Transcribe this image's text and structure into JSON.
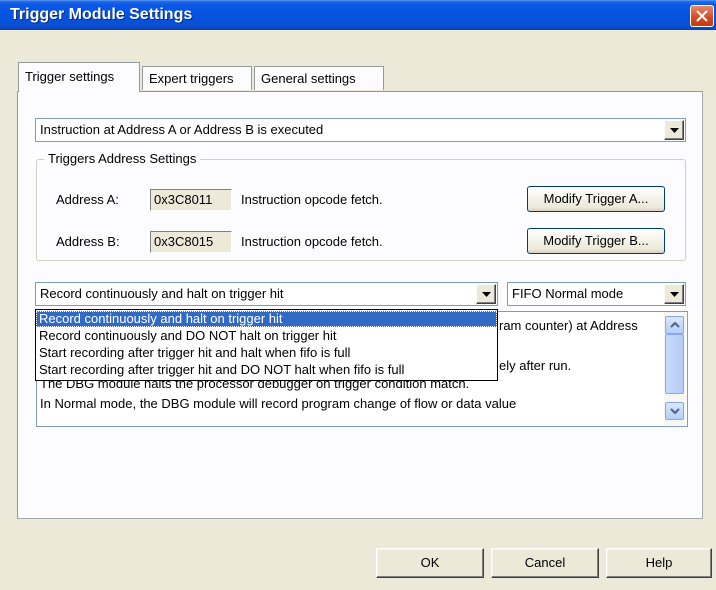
{
  "window": {
    "title": "Trigger Module Settings"
  },
  "tabs": [
    {
      "label": "Trigger settings",
      "active": true
    },
    {
      "label": "Expert triggers",
      "active": false
    },
    {
      "label": "General settings",
      "active": false
    }
  ],
  "trigger_mode": {
    "value": "Instruction at Address A or Address B is executed"
  },
  "address_group": {
    "title": "Triggers Address Settings",
    "address_a": {
      "label": "Address A:",
      "value": "0x3C8011",
      "description": "Instruction opcode fetch.",
      "button": "Modify Trigger A..."
    },
    "address_b": {
      "label": "Address B:",
      "value": "0x3C8015",
      "description": "Instruction opcode fetch.",
      "button": "Modify Trigger B..."
    }
  },
  "record_mode": {
    "value": "Record continuously and halt on trigger hit",
    "options": [
      "Record continuously and halt on trigger hit",
      "Record continuously and DO NOT halt on trigger hit",
      "Start recording after trigger hit and halt when fifo is full",
      "Start recording after trigger hit and DO NOT halt when fifo is full"
    ],
    "selected_index": 0
  },
  "fifo_mode": {
    "value": "FIFO Normal mode"
  },
  "description_text": {
    "line1_tail": "ram counter) at Address",
    "line2_tail": "ely after run.",
    "line3_partial": "The DBG module halts the processor debugger on trigger condition match.",
    "line4": "In Normal mode, the DBG module will record program change of flow or data value"
  },
  "buttons": {
    "ok": "OK",
    "cancel": "Cancel",
    "help": "Help"
  },
  "icons": {
    "close": "close-icon",
    "dropdown": "chevron-down-icon",
    "scroll_up": "arrow-up-icon",
    "scroll_down": "arrow-down-icon"
  },
  "colors": {
    "titlebar": "#0553e0",
    "selection": "#316ac5",
    "dialog_bg": "#ece9d8"
  }
}
